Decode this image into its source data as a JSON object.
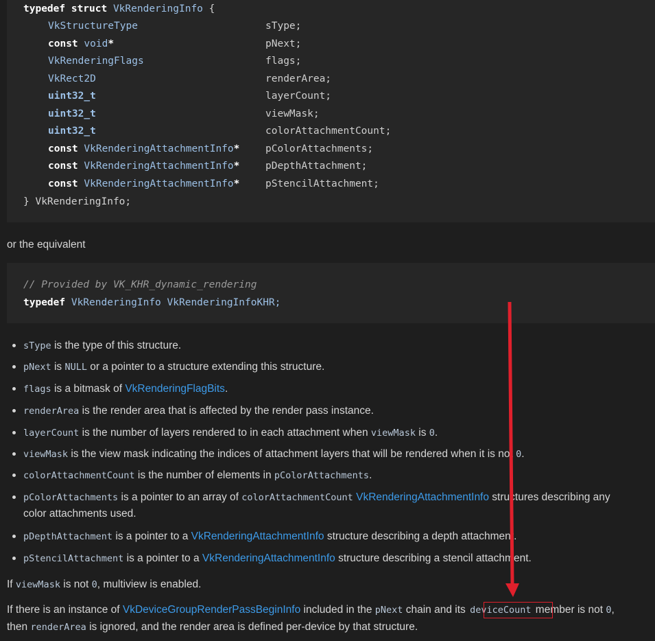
{
  "code1": {
    "line0": {
      "kw": "typedef struct",
      "name": "VkRenderingInfo",
      "brace": "{"
    },
    "members": [
      {
        "const": "",
        "type": "VkStructureType",
        "ptr": "",
        "field": "sType;"
      },
      {
        "const": "const",
        "type": "void",
        "ptr": "*",
        "field": "pNext;"
      },
      {
        "const": "",
        "type": "VkRenderingFlags",
        "ptr": "",
        "field": "flags;"
      },
      {
        "const": "",
        "type": "VkRect2D",
        "ptr": "",
        "field": "renderArea;"
      },
      {
        "const": "",
        "type": "uint32_t",
        "ptr": "",
        "field": "layerCount;"
      },
      {
        "const": "",
        "type": "uint32_t",
        "ptr": "",
        "field": "viewMask;"
      },
      {
        "const": "",
        "type": "uint32_t",
        "ptr": "",
        "field": "colorAttachmentCount;"
      },
      {
        "const": "const",
        "type": "VkRenderingAttachmentInfo",
        "ptr": "*",
        "field": "pColorAttachments;"
      },
      {
        "const": "const",
        "type": "VkRenderingAttachmentInfo",
        "ptr": "*",
        "field": "pDepthAttachment;"
      },
      {
        "const": "const",
        "type": "VkRenderingAttachmentInfo",
        "ptr": "*",
        "field": "pStencilAttachment;"
      }
    ],
    "close": "} VkRenderingInfo;"
  },
  "between_text": "or the equivalent",
  "code2": {
    "comment": "// Provided by VK_KHR_dynamic_rendering",
    "kw": "typedef",
    "rest": "VkRenderingInfo VkRenderingInfoKHR;"
  },
  "bullets": [
    {
      "parts": [
        {
          "t": "c",
          "v": "sType"
        },
        {
          "t": "p",
          "v": " is the type of this structure."
        }
      ]
    },
    {
      "parts": [
        {
          "t": "c",
          "v": "pNext"
        },
        {
          "t": "p",
          "v": " is "
        },
        {
          "t": "c",
          "v": "NULL"
        },
        {
          "t": "p",
          "v": " or a pointer to a structure extending this structure."
        }
      ]
    },
    {
      "parts": [
        {
          "t": "c",
          "v": "flags"
        },
        {
          "t": "p",
          "v": " is a bitmask of "
        },
        {
          "t": "l",
          "v": "VkRenderingFlagBits"
        },
        {
          "t": "p",
          "v": "."
        }
      ]
    },
    {
      "parts": [
        {
          "t": "c",
          "v": "renderArea"
        },
        {
          "t": "p",
          "v": " is the render area that is affected by the render pass instance."
        }
      ]
    },
    {
      "parts": [
        {
          "t": "c",
          "v": "layerCount"
        },
        {
          "t": "p",
          "v": " is the number of layers rendered to in each attachment when "
        },
        {
          "t": "c",
          "v": "viewMask"
        },
        {
          "t": "p",
          "v": " is "
        },
        {
          "t": "c",
          "v": "0"
        },
        {
          "t": "p",
          "v": "."
        }
      ]
    },
    {
      "parts": [
        {
          "t": "c",
          "v": "viewMask"
        },
        {
          "t": "p",
          "v": " is the view mask indicating the indices of attachment layers that will be rendered when it is not "
        },
        {
          "t": "c",
          "v": "0"
        },
        {
          "t": "p",
          "v": "."
        }
      ]
    },
    {
      "parts": [
        {
          "t": "c",
          "v": "colorAttachmentCount"
        },
        {
          "t": "p",
          "v": " is the number of elements in "
        },
        {
          "t": "c",
          "v": "pColorAttachments"
        },
        {
          "t": "p",
          "v": "."
        }
      ]
    },
    {
      "parts": [
        {
          "t": "c",
          "v": "pColorAttachments"
        },
        {
          "t": "p",
          "v": " is a pointer to an array of "
        },
        {
          "t": "c",
          "v": "colorAttachmentCount"
        },
        {
          "t": "p",
          "v": " "
        },
        {
          "t": "l",
          "v": "VkRenderingAttachmentInfo"
        },
        {
          "t": "p",
          "v": " structures describing any"
        }
      ],
      "line2": "color attachments used."
    },
    {
      "parts": [
        {
          "t": "c",
          "v": "pDepthAttachment"
        },
        {
          "t": "p",
          "v": " is a pointer to a "
        },
        {
          "t": "l",
          "v": "VkRenderingAttachmentInfo"
        },
        {
          "t": "p",
          "v": " structure describing a depth attachment."
        }
      ]
    },
    {
      "parts": [
        {
          "t": "c",
          "v": "pStencilAttachment"
        },
        {
          "t": "p",
          "v": " is a pointer to a "
        },
        {
          "t": "l",
          "v": "VkRenderingAttachmentInfo"
        },
        {
          "t": "p",
          "v": " structure describing a stencil attachment."
        }
      ]
    }
  ],
  "para1": {
    "pre": "If ",
    "code": "viewMask",
    "mid": " is not ",
    "zero": "0",
    "post": ", multiview is enabled."
  },
  "para2": {
    "pre": "If there is an instance of ",
    "link": "VkDeviceGroupRenderPassBeginInfo",
    "mid": " included in the ",
    "code1": "pNext",
    "mid2": " chain and its ",
    "highlight": "deviceCount",
    "mid3": " member is not ",
    "zero": "0",
    "end": ",",
    "line2_pre": "then ",
    "code2": "renderArea",
    "line2_post": " is ignored, and the render area is defined per-device by that structure."
  },
  "annotation_color": "#e0202c"
}
